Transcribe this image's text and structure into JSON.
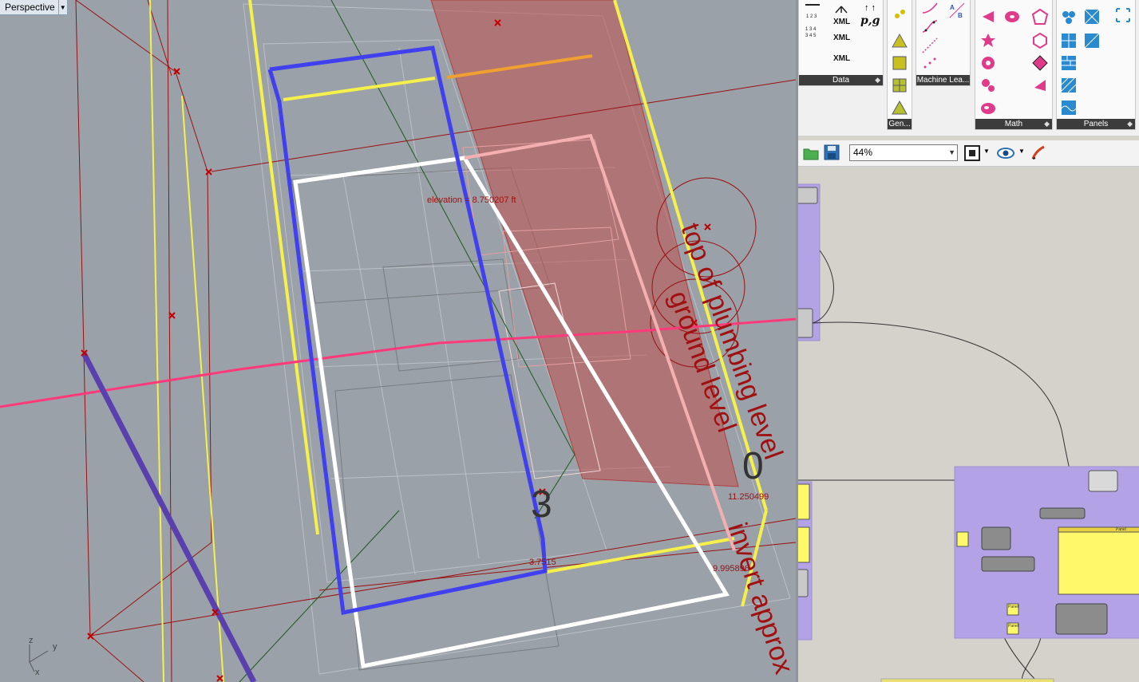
{
  "viewport": {
    "name": "Perspective",
    "annotations": {
      "elevation": "elevation = 8.750207 ft",
      "value_a": "3.7515",
      "value_b": "11.250499",
      "value_c": "9.995896",
      "big_number_3": "3",
      "big_number_0": "0",
      "label_top": "top of plumbing level",
      "label_ground": "ground level",
      "label_invert": "invert approx"
    },
    "axes": {
      "z": "z",
      "y": "y",
      "x": "x"
    }
  },
  "ribbon": {
    "groups": [
      {
        "id": "data",
        "label": "Data"
      },
      {
        "id": "gen",
        "label": "Gen..."
      },
      {
        "id": "machine",
        "label": "Machine Lea..."
      },
      {
        "id": "math",
        "label": "Math"
      },
      {
        "id": "panels",
        "label": "Panels"
      }
    ],
    "xml_labels": [
      "XML",
      "XML",
      "XML"
    ],
    "pg_label": "p,g"
  },
  "toolbar": {
    "zoom": "44%"
  },
  "canvas": {
    "panel_title": "Panel",
    "small_labels": [
      "Panel",
      "Panel"
    ]
  },
  "colors": {
    "viewport_bg": "#9ba1a8",
    "blue_curve": "#4040ee",
    "red_surface": "#c0504d",
    "pink_line": "#ff3a7a",
    "yellow_line": "#f5f04a",
    "gh_group": "#b3a3e6",
    "gh_panel_yellow": "#fff86a"
  }
}
